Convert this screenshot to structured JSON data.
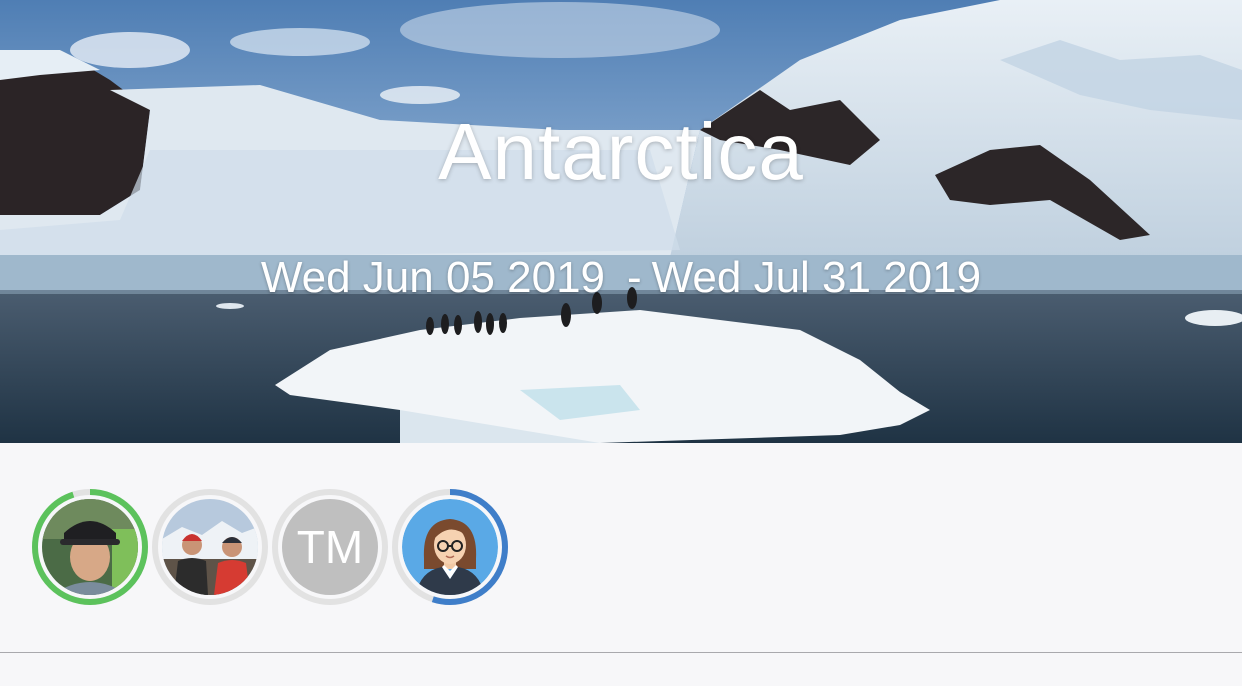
{
  "trip": {
    "title": "Antarctica",
    "start_date": "Wed Jun 05 2019",
    "separator": "-",
    "end_date": "Wed Jul 31 2019"
  },
  "members": [
    {
      "type": "photo",
      "description": "man with cap",
      "ring_color": "#5cc25c",
      "ring_progress": 0.95
    },
    {
      "type": "photo",
      "description": "two people outdoors",
      "ring_color": "#e2e2e2",
      "ring_progress": 0
    },
    {
      "type": "initials",
      "initials": "TM",
      "ring_color": "#e2e2e2",
      "ring_progress": 0
    },
    {
      "type": "illustration",
      "description": "woman with glasses avatar",
      "ring_color": "#3f7ec9",
      "ring_progress": 0.55
    }
  ],
  "colors": {
    "background": "#f7f7f9",
    "divider": "#a9a9ad",
    "progress_green": "#5cc25c",
    "progress_blue": "#3f7ec9"
  }
}
